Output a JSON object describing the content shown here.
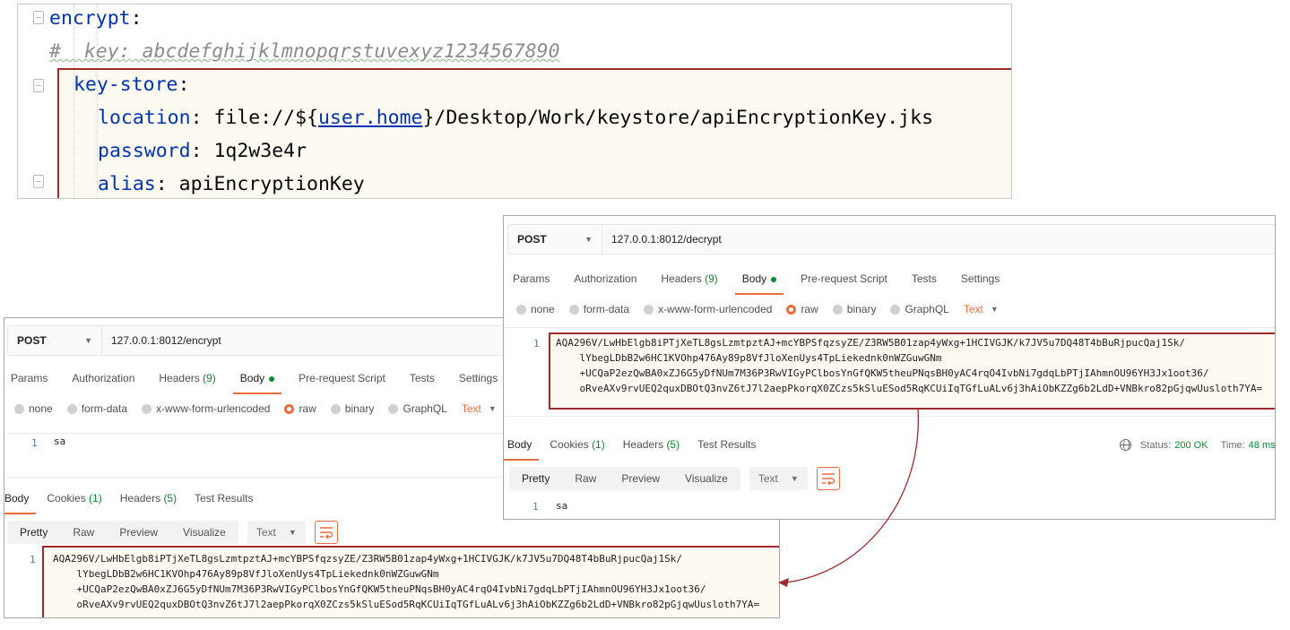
{
  "yaml": {
    "line1_key": "encrypt",
    "line2_comment": "#  key: abcdefghijklmnopqrstuvexyz1234567890",
    "line3_key": "key-store",
    "line4_key": "location",
    "line4_prefix": "file://${",
    "line4_var": "user.home",
    "line4_suffix": "}/Desktop/Work/keystore/apiEncryptionKey.jks",
    "line5_key": "password",
    "line5_value": "1q2w3e4r",
    "line6_key": "alias",
    "line6_value": "apiEncryptionKey",
    "colon": ":"
  },
  "encrypt_panel": {
    "method": "POST",
    "url": "127.0.0.1:8012/encrypt",
    "tabs": {
      "params": "Params",
      "authorization": "Authorization",
      "headers": "Headers",
      "headers_count": "(9)",
      "body": "Body",
      "prerequest": "Pre-request Script",
      "tests": "Tests",
      "settings": "Settings"
    },
    "body_types": {
      "none": "none",
      "form_data": "form-data",
      "urlencoded": "x-www-form-urlencoded",
      "raw": "raw",
      "binary": "binary",
      "graphql": "GraphQL",
      "format": "Text"
    },
    "request_line_no": "1",
    "request_body": "sa",
    "response_tabs": {
      "body": "Body",
      "cookies": "Cookies",
      "cookies_count": "(1)",
      "headers": "Headers",
      "headers_count": "(5)",
      "test_results": "Test Results"
    },
    "view": {
      "pretty": "Pretty",
      "raw": "Raw",
      "preview": "Preview",
      "visualize": "Visualize",
      "format": "Text"
    },
    "response_line_no": "1",
    "response_lines": [
      "AQA296V/LwHbElgb8iPTjXeTL8gsLzmtpztAJ+mcYBPSfqzsyZE/Z3RW5B01zap4yWxg+1HCIVGJK/k7JV5u7DQ48T4bBuRjpucQaj1Sk/",
      "    lYbegLDbB2w6HC1KVOhp476Ay89p8VfJloXenUys4TpLiekednk0nWZGuwGNm",
      "    +UCQaP2ezQwBA0xZJ6G5yDfNUm7M36P3RwVIGyPClbosYnGfQKW5theuPNqsBH0yAC4rqO4IvbNi7gdqLbPTjIAhmnOU96YH3Jx1oot36/",
      "    oRveAXv9rvUEQ2quxDBOtQ3nvZ6tJ7l2aepPkorqX0ZCzs5kSluESod5RqKCUiIqTGfLuALv6j3hAiObKZZg6b2LdD+VNBkro82pGjqwUusloth7YA="
    ]
  },
  "decrypt_panel": {
    "method": "POST",
    "url": "127.0.0.1:8012/decrypt",
    "tabs": {
      "params": "Params",
      "authorization": "Authorization",
      "headers": "Headers",
      "headers_count": "(9)",
      "body": "Body",
      "prerequest": "Pre-request Script",
      "tests": "Tests",
      "settings": "Settings"
    },
    "body_types": {
      "none": "none",
      "form_data": "form-data",
      "urlencoded": "x-www-form-urlencoded",
      "raw": "raw",
      "binary": "binary",
      "graphql": "GraphQL",
      "format": "Text"
    },
    "request_line_no": "1",
    "request_lines": [
      "AQA296V/LwHbElgb8iPTjXeTL8gsLzmtpztAJ+mcYBPSfqzsyZE/Z3RW5B01zap4yWxg+1HCIVGJK/k7JV5u7DQ48T4bBuRjpucQaj1Sk/",
      "    lYbegLDbB2w6HC1KVOhp476Ay89p8VfJloXenUys4TpLiekednk0nWZGuwGNm",
      "    +UCQaP2ezQwBA0xZJ6G5yDfNUm7M36P3RwVIGyPClbosYnGfQKW5theuPNqsBH0yAC4rqO4IvbNi7gdqLbPTjIAhmnOU96YH3Jx1oot36/",
      "    oRveAXv9rvUEQ2quxDBOtQ3nvZ6tJ7l2aepPkorqX0ZCzs5kSluESod5RqKCUiIqTGfLuALv6j3hAiObKZZg6b2LdD+VNBkro82pGjqwUusloth7YA="
    ],
    "response_tabs": {
      "body": "Body",
      "cookies": "Cookies",
      "cookies_count": "(1)",
      "headers": "Headers",
      "headers_count": "(5)",
      "test_results": "Test Results"
    },
    "status_label": "Status:",
    "status_value": "200 OK",
    "time_label": "Time:",
    "time_value": "48 ms",
    "view": {
      "pretty": "Pretty",
      "raw": "Raw",
      "preview": "Preview",
      "visualize": "Visualize",
      "format": "Text"
    },
    "response_line_no": "1",
    "response_body": "sa"
  },
  "colors": {
    "accent": "#f26b3a",
    "highlight_border": "#9e2a2a",
    "success": "#0b8a2f",
    "yaml_key": "#0033b3"
  }
}
